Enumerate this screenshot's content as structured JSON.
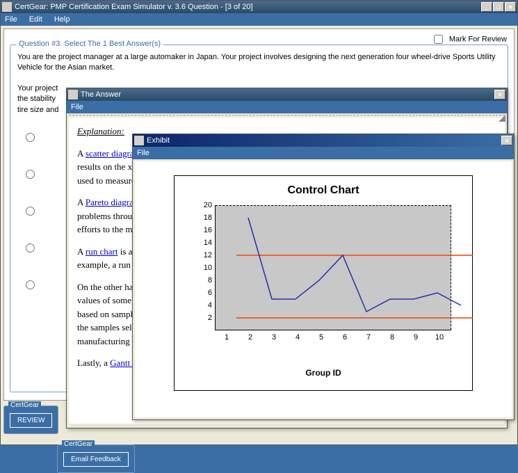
{
  "main_window": {
    "title": "CertGear:  PMP Certification Exam Simulator  v. 3.6   Question - [3 of 20]",
    "menu": {
      "file": "File",
      "edit": "Edit",
      "help": "Help"
    },
    "mark_for_review": "Mark For Review",
    "question_header": "Question #3.  Select The 1 Best Answer(s)",
    "question_body_1": "You are the project manager at a large automaker in Japan. Your project involves designing the next generation four wheel-drive Sports Utility Vehicle for the Asian market.",
    "question_body_2": "Your project",
    "question_body_3": "the stability",
    "question_body_4": "tire size and",
    "panel_label": "CertGear",
    "review_btn": "REVIEW",
    "email_btn": "Email Feedback"
  },
  "answer_window": {
    "title": "The Answer",
    "menu_file": "File",
    "explanation_label": "Explanation:",
    "p1_a": "A ",
    "p1_link": "scatter diagram",
    "p1_b": " ",
    "p1_c": "results on the x ax",
    "p1_d": "used to measure th",
    "p2_a": "A ",
    "p2_link": "Pareto diagram",
    "p2_b": " ",
    "p2_c": "problems through ",
    "p2_d": "efforts to the most",
    "p3_a": "A ",
    "p3_link": "run chart",
    "p3_b": " is a li",
    "p3_c": "example, a run cha",
    "p4_a": "On the other hand,",
    "p4_b": "values of some sta",
    "p4_c": "based on sample v",
    "p4_d": "the samples selecte",
    "p4_e": "manufacturing bat",
    "p5_a": "Lastly, a ",
    "p5_link": "Gantt ch"
  },
  "exhibit_window": {
    "title": "Exhibit",
    "menu_file": "File"
  },
  "chart_data": {
    "type": "line",
    "title": "Control Chart",
    "xlabel": "Group ID",
    "ylabel": "",
    "x": [
      1,
      2,
      3,
      4,
      5,
      6,
      7,
      8,
      9,
      10
    ],
    "values": [
      18,
      5,
      5,
      8,
      12,
      3,
      5,
      5,
      6,
      4
    ],
    "upper_limit": 12,
    "lower_limit": 2,
    "ylim": [
      0,
      20
    ],
    "y_ticks": [
      20,
      18,
      16,
      14,
      12,
      10,
      8,
      6,
      4,
      2
    ]
  }
}
